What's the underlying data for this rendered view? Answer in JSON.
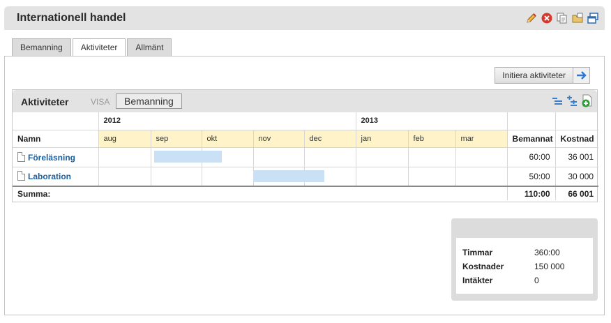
{
  "window": {
    "title": "Internationell handel"
  },
  "tabs": [
    {
      "label": "Bemanning",
      "active": false
    },
    {
      "label": "Aktiviteter",
      "active": true
    },
    {
      "label": "Allmänt",
      "active": false
    }
  ],
  "toolbar": {
    "init_label": "Initiera aktiviteter"
  },
  "activities": {
    "title": "Aktiviteter",
    "visa_label": "VISA",
    "view_button": "Bemanning",
    "years": [
      "2012",
      "2013"
    ],
    "months": [
      "aug",
      "sep",
      "okt",
      "nov",
      "dec",
      "jan",
      "feb",
      "mar"
    ],
    "headers": {
      "name": "Namn",
      "staffed": "Bemannat",
      "cost": "Kostnad"
    },
    "rows": [
      {
        "name": "Föreläsning",
        "staffed": "60:00",
        "cost": "36 001"
      },
      {
        "name": "Laboration",
        "staffed": "50:00",
        "cost": "30 000"
      }
    ],
    "sum": {
      "label": "Summa:",
      "staffed": "110:00",
      "cost": "66 001"
    }
  },
  "summary": {
    "rows": [
      {
        "key": "Timmar",
        "value": "360:00"
      },
      {
        "key": "Kostnader",
        "value": "150 000"
      },
      {
        "key": "Intäkter",
        "value": "0"
      }
    ]
  },
  "colors": {
    "month_header_bg": "#fff4c9",
    "gantt_bar": "#c9e0f5",
    "link": "#1c5f9e"
  }
}
